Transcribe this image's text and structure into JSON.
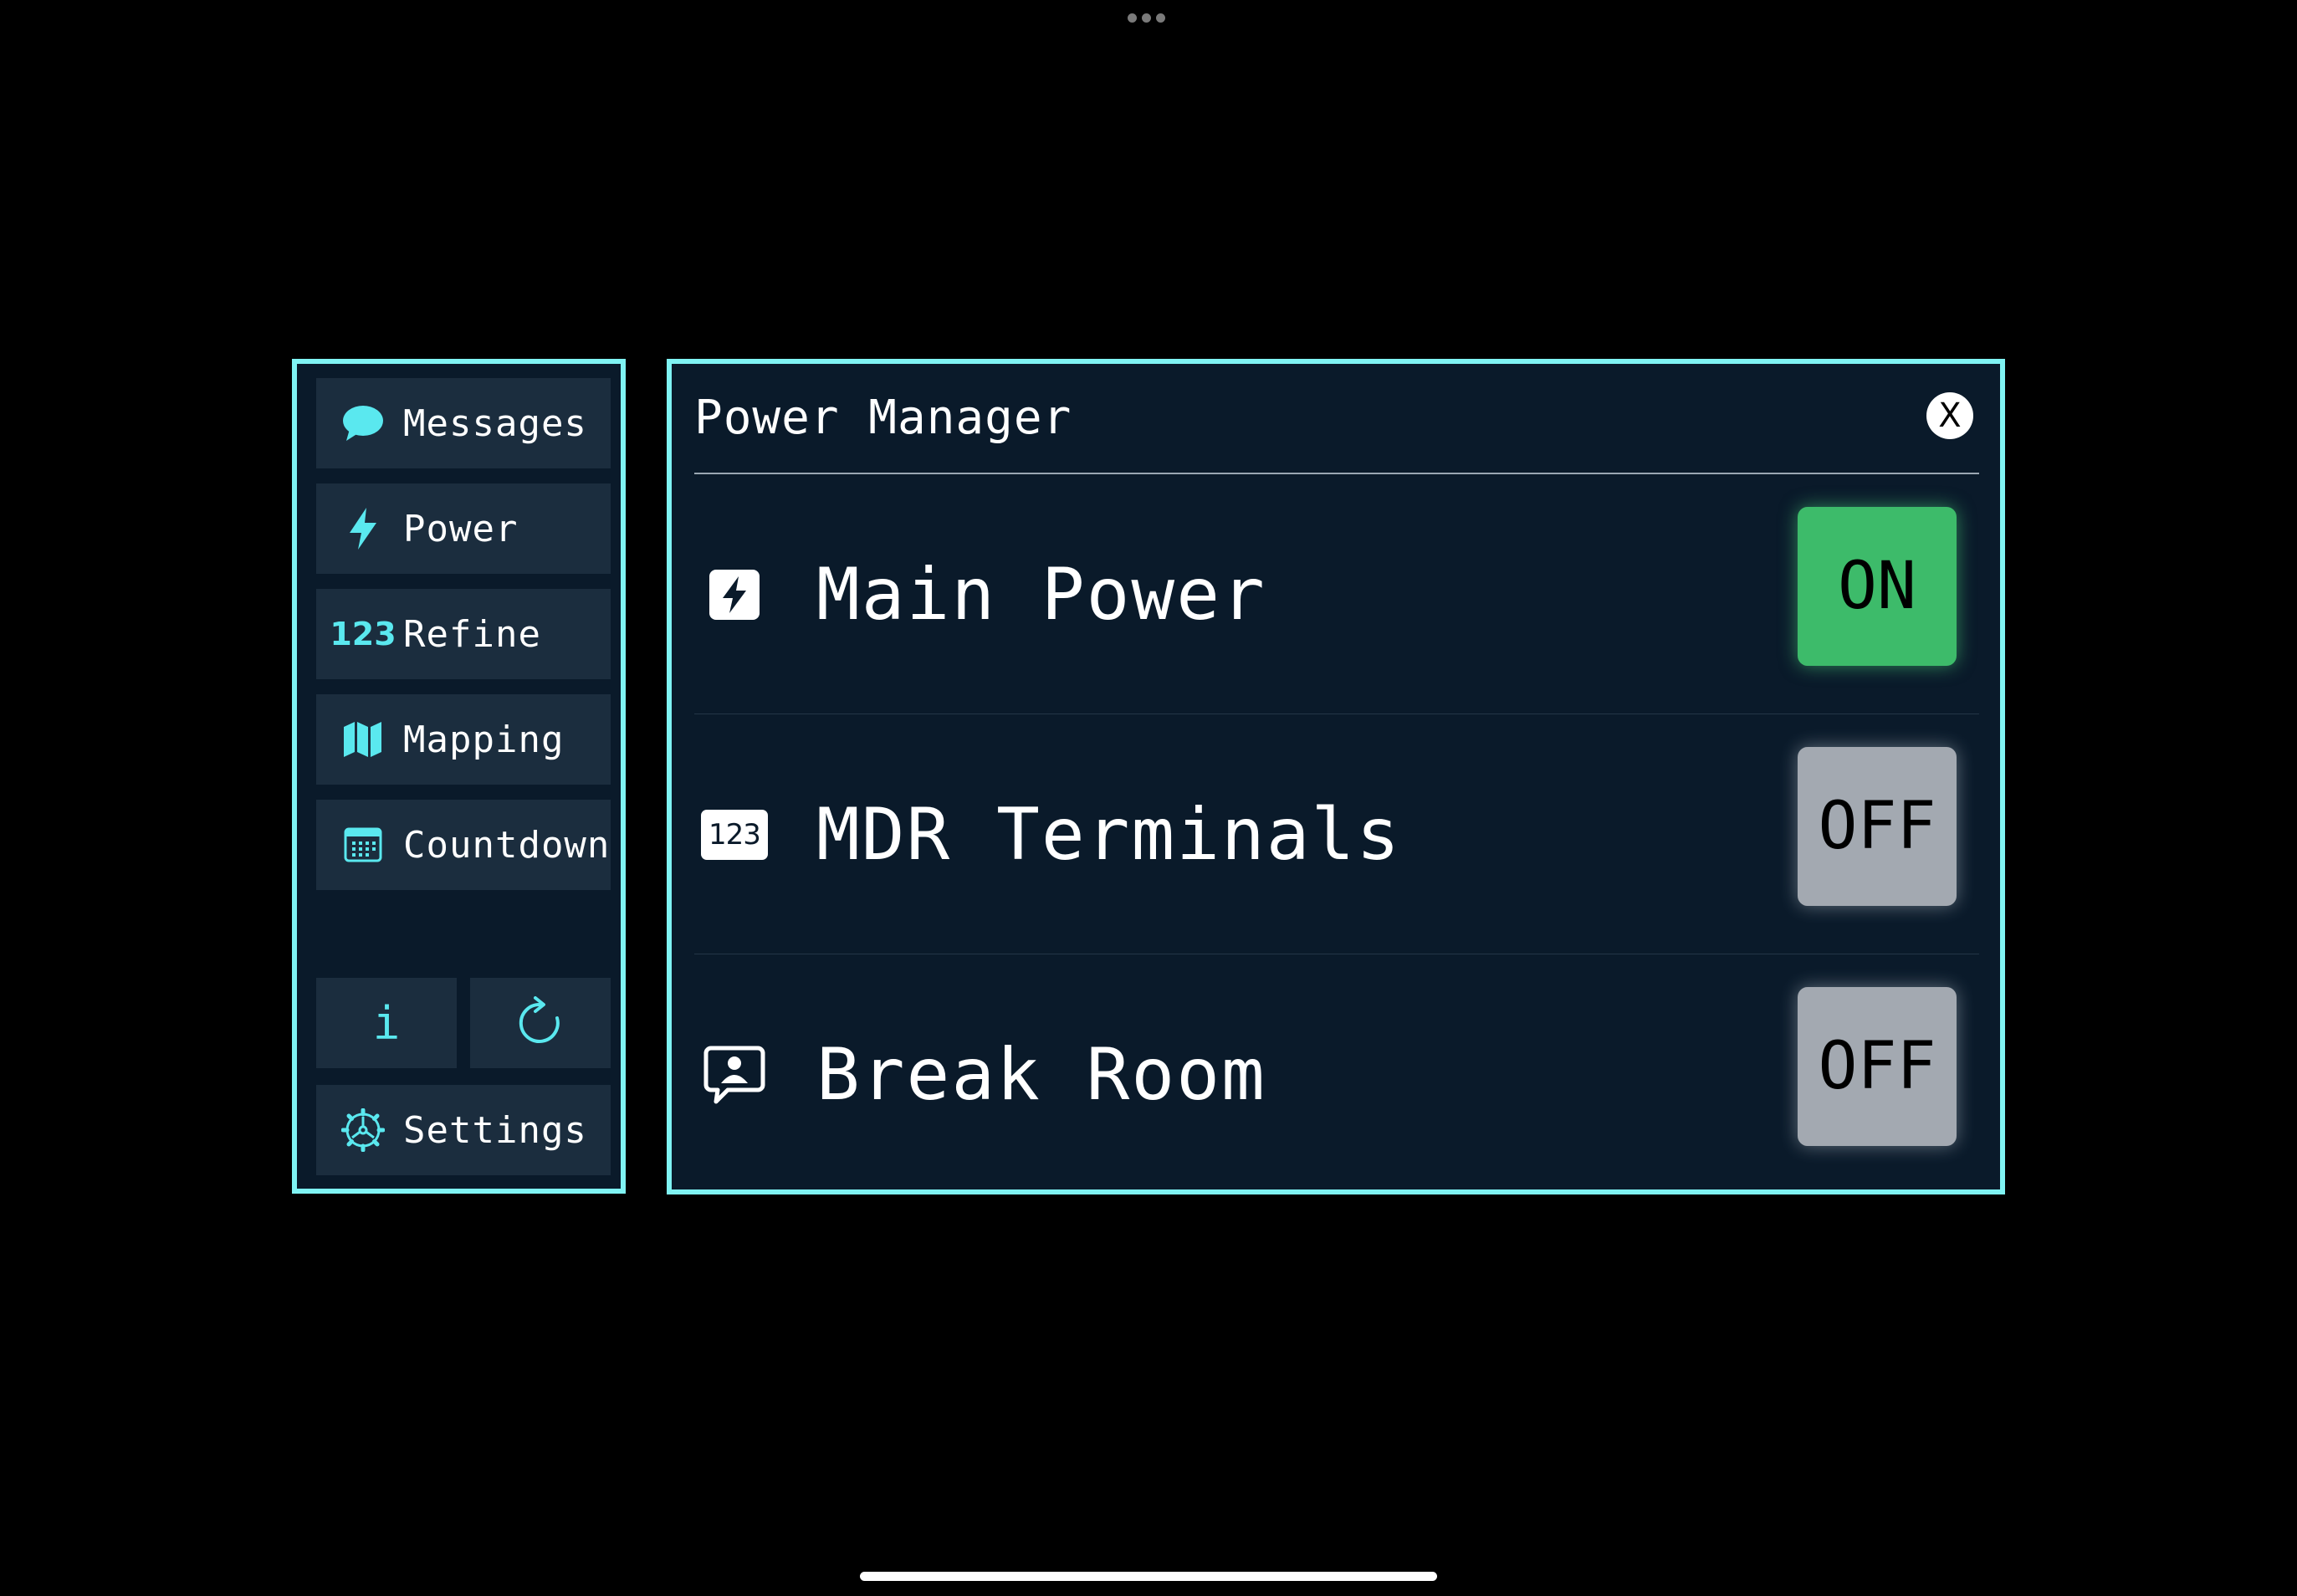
{
  "sidebar": {
    "items": [
      {
        "label": "Messages",
        "icon": "speech-bubble-icon"
      },
      {
        "label": "Power",
        "icon": "bolt-icon"
      },
      {
        "label": "Refine",
        "icon_text": "123"
      },
      {
        "label": "Mapping",
        "icon": "map-icon"
      },
      {
        "label": "Countdown",
        "icon": "calendar-icon"
      }
    ],
    "info_glyph": "i",
    "settings_label": "Settings"
  },
  "panel": {
    "title": "Power Manager",
    "close_glyph": "X",
    "rows": [
      {
        "label": "Main Power",
        "state": "ON",
        "icon": "bolt-square-icon"
      },
      {
        "label": "MDR Terminals",
        "state": "OFF",
        "icon_text": "123"
      },
      {
        "label": "Break Room",
        "state": "OFF",
        "icon": "person-bubble-icon"
      }
    ]
  },
  "colors": {
    "accent": "#7ff3f3",
    "icon": "#5ae8ef",
    "panel_bg": "#0a1a2a",
    "button_bg": "#1b2d3e",
    "on": "#3dbb6a",
    "off": "#a3a9b1"
  }
}
